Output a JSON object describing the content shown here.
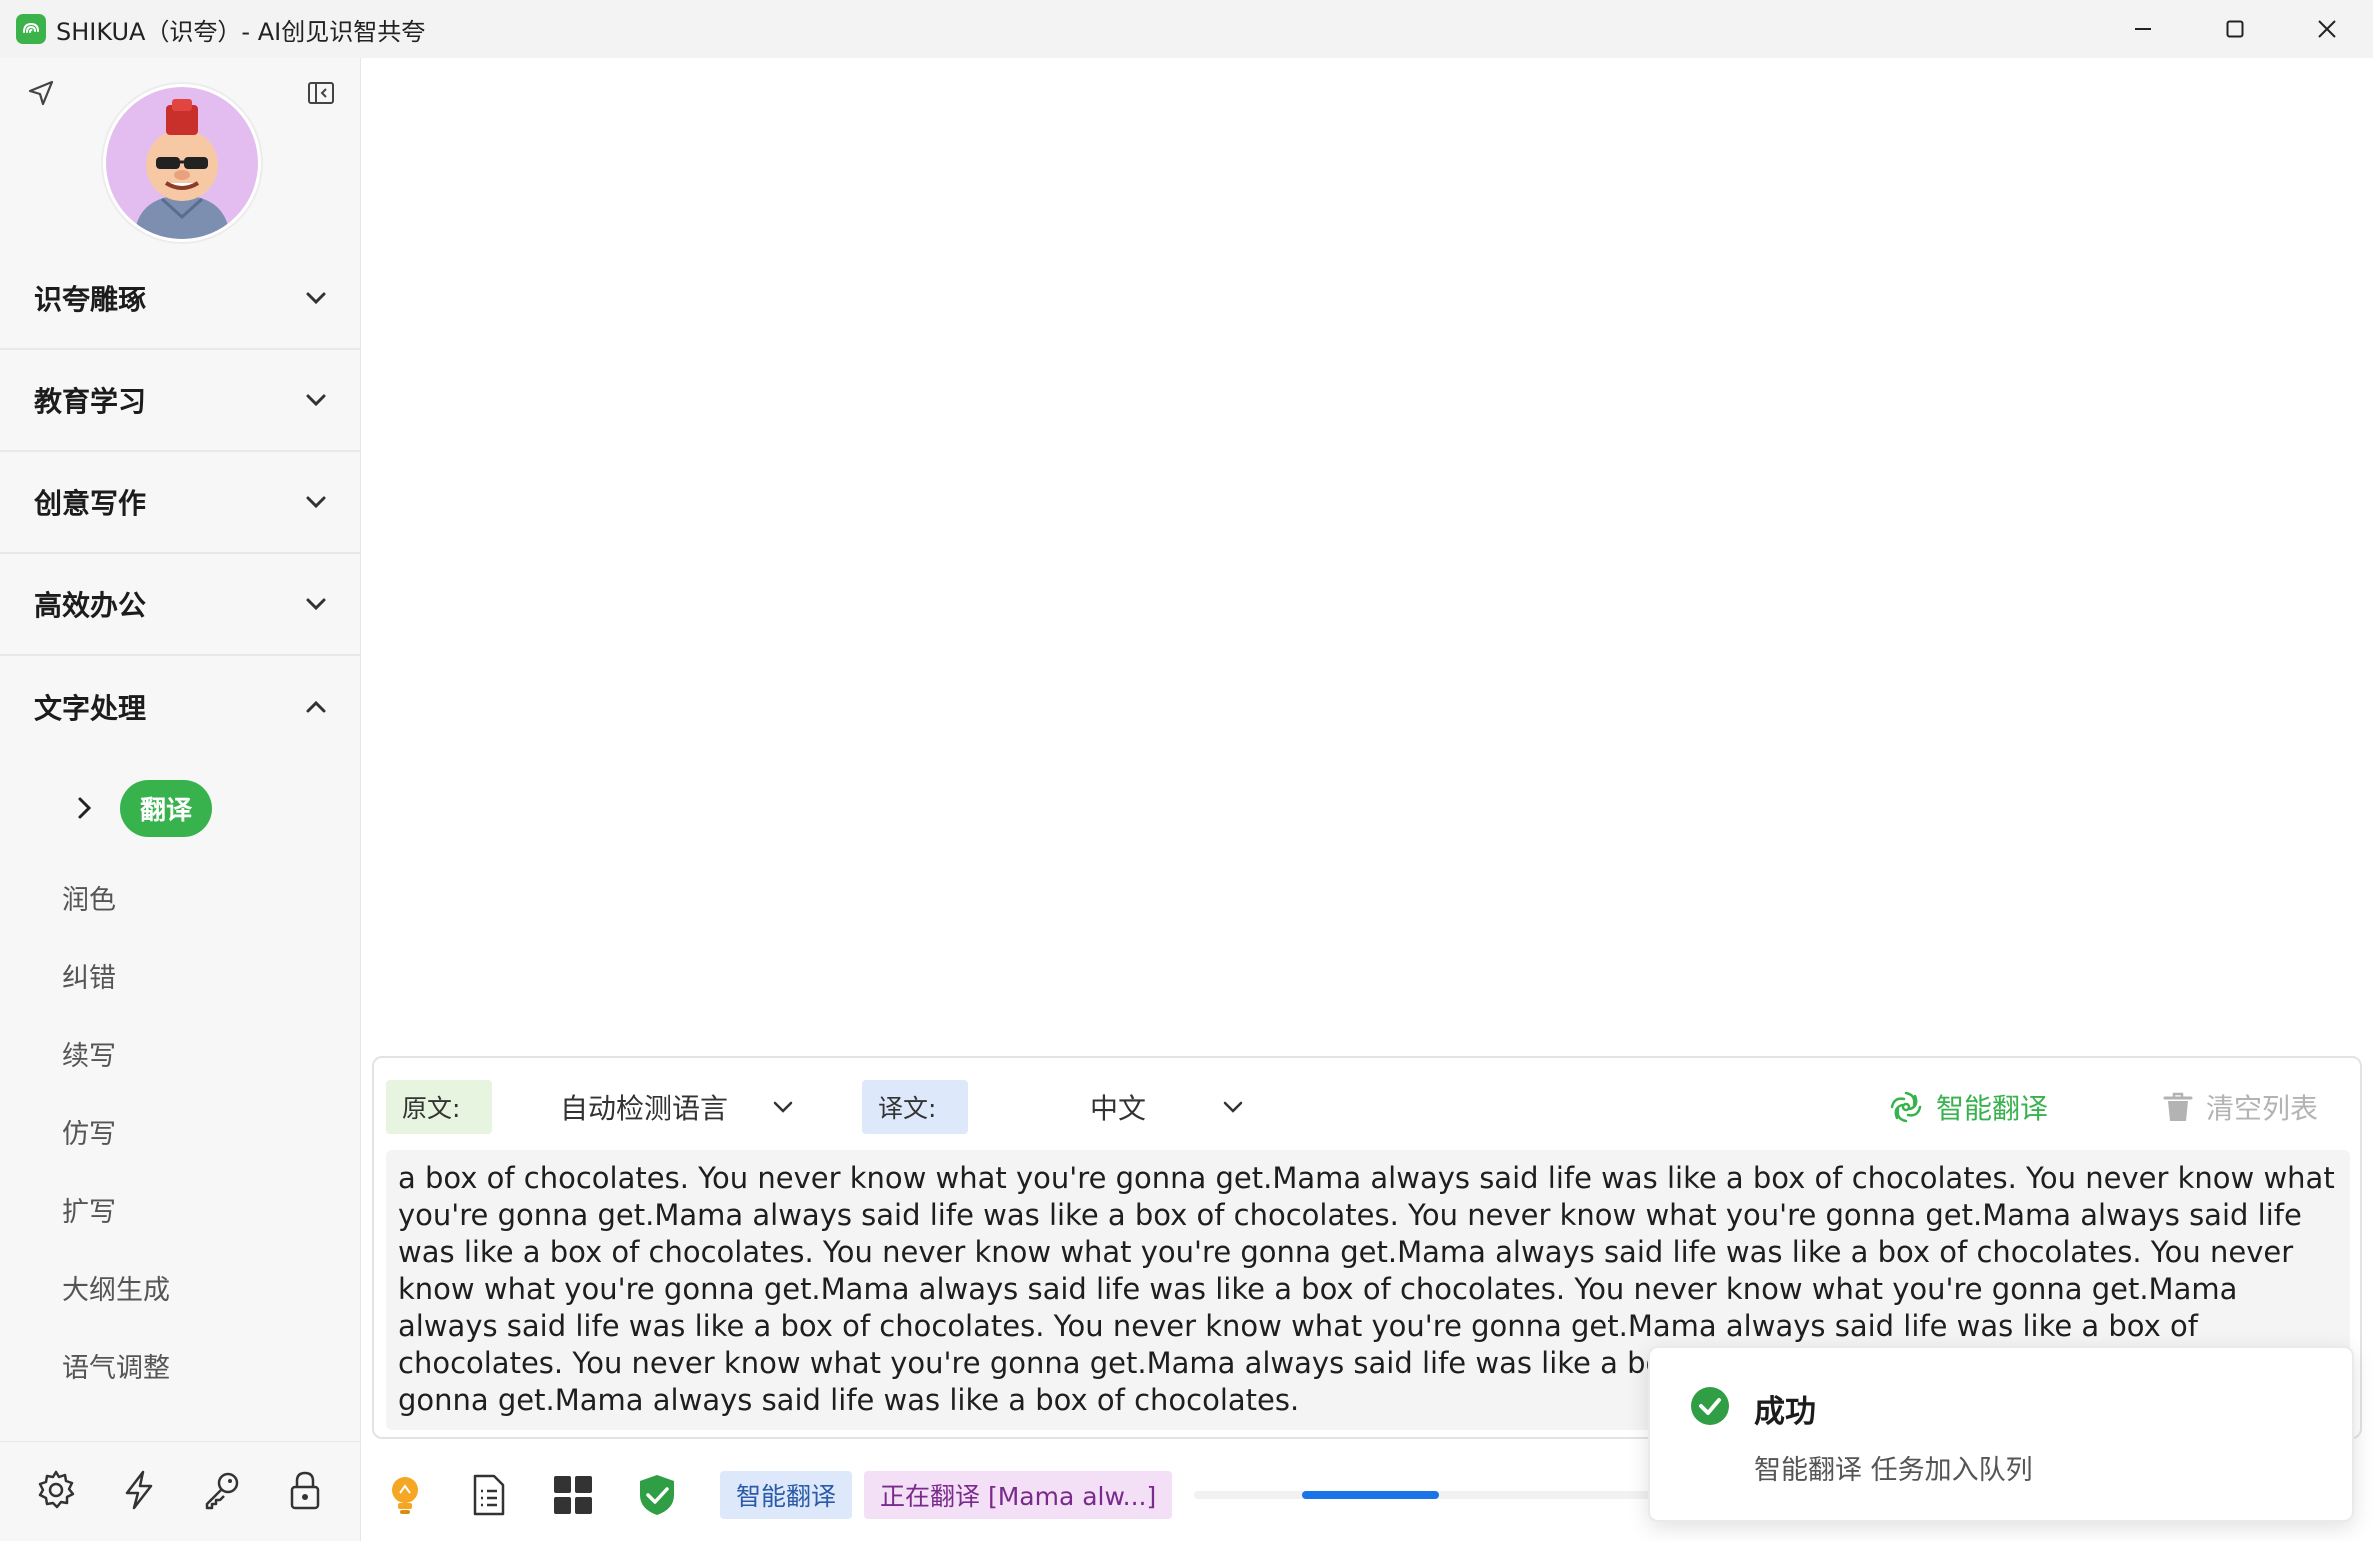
{
  "window": {
    "title": "SHIKUA（识夸）- AI创见识智共夸"
  },
  "sidebar": {
    "groups": [
      {
        "label": "识夸雕琢",
        "state": "collapsed"
      },
      {
        "label": "教育学习",
        "state": "collapsed"
      },
      {
        "label": "创意写作",
        "state": "collapsed"
      },
      {
        "label": "高效办公",
        "state": "collapsed"
      },
      {
        "label": "文字处理",
        "state": "expanded"
      }
    ],
    "active_item": "翻译",
    "sub_items": [
      "润色",
      "纠错",
      "续写",
      "仿写",
      "扩写",
      "大纲生成",
      "语气调整"
    ],
    "bottom_icons": [
      "gear-icon",
      "lightning-icon",
      "key-icon",
      "lock-icon"
    ]
  },
  "translate": {
    "source_label": "原文:",
    "source_lang": "自动检测语言",
    "target_label": "译文:",
    "target_lang": "中文",
    "smart_button": "智能翻译",
    "clear_button": "清空列表",
    "text": "a box of chocolates. You never know what you're gonna get.Mama always said life was like a box of chocolates. You never know what you're gonna get.Mama always said life was like a box of chocolates. You never know what you're gonna get.Mama always said life was like a box of chocolates. You never know what you're gonna get.Mama always said life was like a box of chocolates. You never know what you're gonna get.Mama always said life was like a box of chocolates. You never know what you're gonna get.Mama always said life was like a box of chocolates. You never know what you're gonna get.Mama always said life was like a box of chocolates. You never know what you're gonna get.Mama always said life was like a box of chocolates. You never know what you're gonna get.Mama always said life was like a box of chocolates."
  },
  "statusbar": {
    "tag_mode": "智能翻译",
    "tag_progress": "正在翻译 [Mama alw...]",
    "progress": {
      "start_fraction": 0.22,
      "end_fraction": 0.5
    },
    "accent": "#1a73e8"
  },
  "toast": {
    "title": "成功",
    "message": "智能翻译 任务加入队列"
  },
  "colors": {
    "brand_green": "#37b24d",
    "source_tag_bg": "#e6f4e0",
    "target_tag_bg": "#dde9fa"
  }
}
